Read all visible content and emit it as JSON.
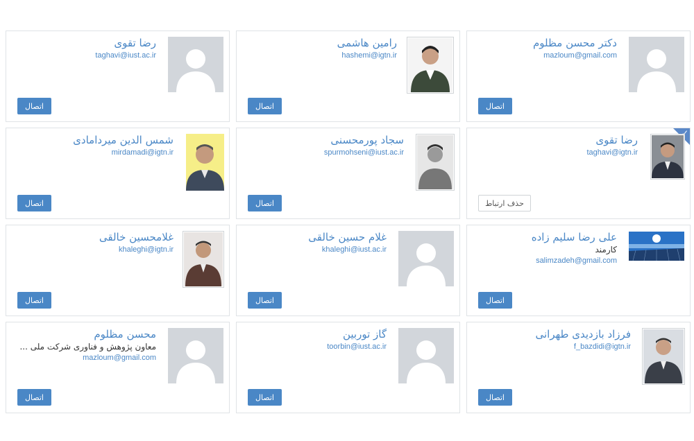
{
  "cards": [
    {
      "name": "رضا تقوی",
      "email": "taghavi@iust.ac.ir",
      "action": "اتصال",
      "photo": "placeholder-avatar"
    },
    {
      "name": "رامین هاشمی",
      "email": "hashemi@igtn.ir",
      "action": "اتصال",
      "photo": "photo"
    },
    {
      "name": "دکتر محسن مظلوم",
      "email": "mazloum@gmail.com",
      "action": "اتصال",
      "photo": "placeholder-avatar"
    },
    {
      "name": "شمس الدین میردامادی",
      "email": "mirdamadi@igtn.ir",
      "action": "اتصال",
      "photo": "photo"
    },
    {
      "name": "سجاد پورمحسنی",
      "email": "spurmohseni@iust.ac.ir",
      "action": "اتصال",
      "photo": "photo"
    },
    {
      "name": "رضا تقوی",
      "email": "taghavi@igtn.ir",
      "action": "حذف ارتباط",
      "photo": "photo",
      "connected": true,
      "check_icon": "check-icon"
    },
    {
      "name": "غلامحسین خالقی",
      "email": "khaleghi@igtn.ir",
      "action": "اتصال",
      "photo": "photo"
    },
    {
      "name": "غلام حسین خالقی",
      "email": "khaleghi@iust.ac.ir",
      "action": "اتصال",
      "photo": "placeholder-avatar"
    },
    {
      "name": "علی رضا سلیم زاده",
      "role": "کارمند",
      "email": "salimzadeh@gmail.com",
      "action": "اتصال",
      "photo": "solar-panel-photo"
    },
    {
      "name": "محسن مظلوم",
      "role": "معاون پژوهش و فناوری شرکت ملی ...",
      "email": "mazloum@gmail.com",
      "action": "اتصال",
      "photo": "placeholder-avatar"
    },
    {
      "name": "گاز توربین",
      "email": "toorbin@iust.ac.ir",
      "action": "اتصال",
      "photo": "placeholder-avatar"
    },
    {
      "name": "فرزاد بازدیدی طهرانی",
      "email": "f_bazdidi@igtn.ir",
      "action": "اتصال",
      "photo": "photo"
    }
  ],
  "colors": {
    "accent": "#4a87c6",
    "placeholder": "#d2d6db",
    "border": "#dfe3e6"
  }
}
